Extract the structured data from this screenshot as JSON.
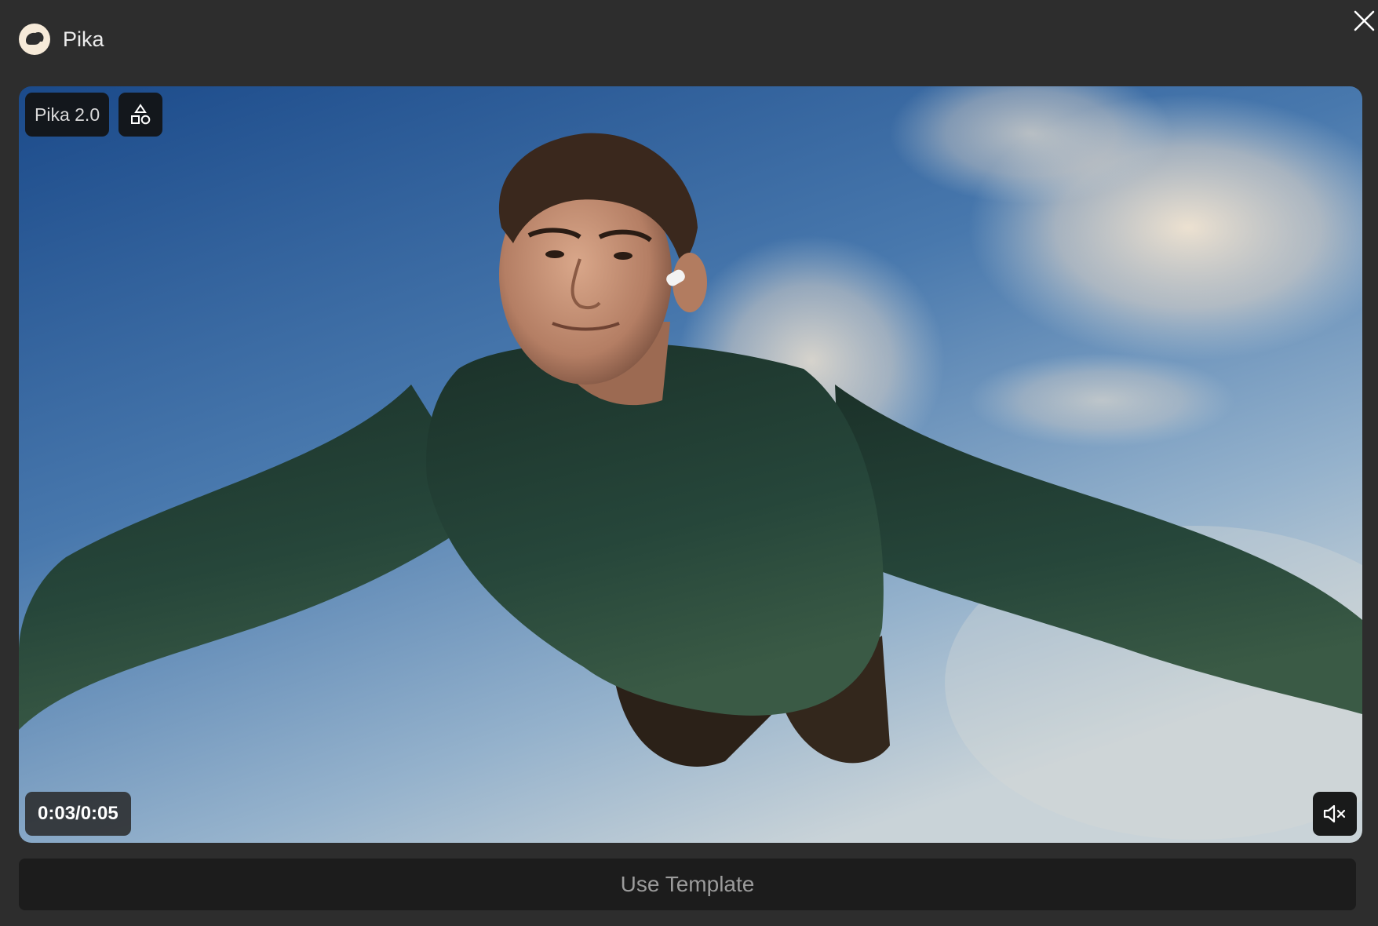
{
  "header": {
    "app_name": "Pika",
    "logo_icon": "pika-rabbit-icon",
    "close_icon": "close-icon"
  },
  "video": {
    "model_badge": "Pika 2.0",
    "shapes_icon": "shapes-icon",
    "timecode": "0:03/0:05",
    "mute_icon": "speaker-muted-icon",
    "playback_position_fraction": 0.6
  },
  "actions": {
    "use_template_label": "Use Template"
  },
  "colors": {
    "background": "#2d2d2d",
    "logo_bg": "#f6ead8",
    "button_bg": "#1c1c1c",
    "sky_top": "#1f4f8f",
    "sky_bottom": "#c4cfd6"
  }
}
